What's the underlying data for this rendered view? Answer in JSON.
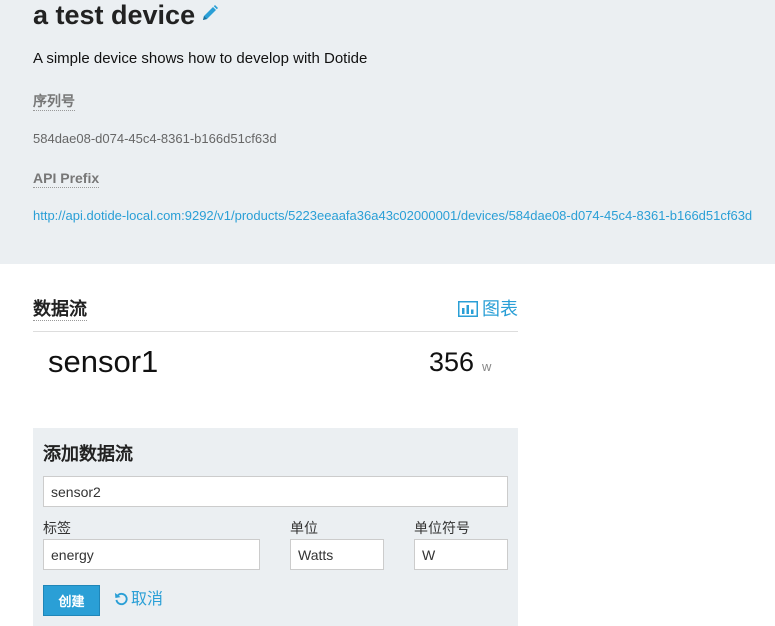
{
  "device": {
    "title": "a test device",
    "description": "A simple device shows how to develop with Dotide",
    "serial_label": "序列号",
    "serial_value": "584dae08-d074-45c4-8361-b166d51cf63d",
    "api_prefix_label": "API Prefix",
    "api_prefix_url": "http://api.dotide-local.com:9292/v1/products/5223eeaafa36a43c02000001/devices/584dae08-d074-45c4-8361-b166d51cf63d"
  },
  "streams": {
    "title": "数据流",
    "chart_link_label": "图表",
    "items": [
      {
        "name": "sensor1",
        "value": "356",
        "unit": "w"
      }
    ]
  },
  "add_form": {
    "title": "添加数据流",
    "name_value": "sensor2",
    "tag_label": "标签",
    "tag_value": "energy",
    "unit_label": "单位",
    "unit_value": "Watts",
    "symbol_label": "单位符号",
    "symbol_value": "W",
    "create_label": "创建",
    "cancel_label": "取消"
  },
  "colors": {
    "accent": "#2a9fd6",
    "panel_bg": "#ebeff2"
  },
  "icons": {
    "edit": "pencil-icon",
    "chart": "bar-chart-icon",
    "cancel": "undo-icon"
  }
}
